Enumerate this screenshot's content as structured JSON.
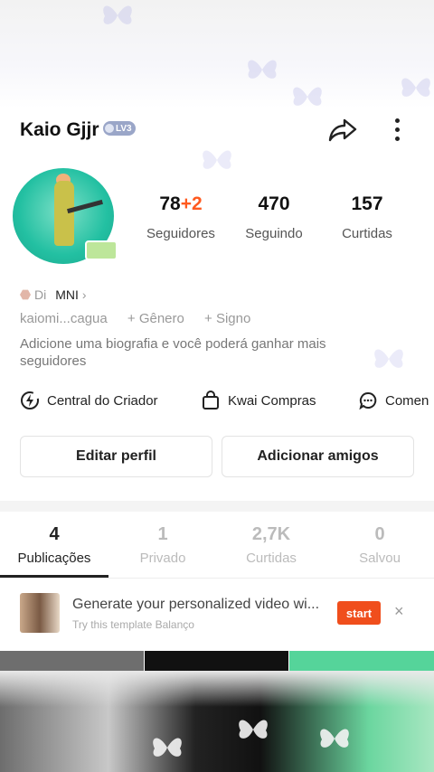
{
  "profile": {
    "username": "Kaio Gjjr",
    "level": "LV3",
    "stats": {
      "followers_num": "78",
      "followers_new": "+2",
      "followers_label": "Seguidores",
      "following_num": "470",
      "following_label": "Seguindo",
      "likes_num": "157",
      "likes_label": "Curtidas"
    },
    "tag_text": "Di",
    "tag_mn": "MNI",
    "tag_arrow": "›",
    "info": {
      "handle": "kaiomi...cagua",
      "gender": "+ Gênero",
      "sign": "+ Signo"
    },
    "bio": "Adicione uma biografia e você poderá ganhar mais seguidores"
  },
  "shortcuts": {
    "creator": "Central do Criador",
    "shop": "Kwai Compras",
    "comments": "Comen"
  },
  "buttons": {
    "edit": "Editar perfil",
    "add_friends": "Adicionar amigos"
  },
  "tabs": [
    {
      "num": "4",
      "label": "Publicações"
    },
    {
      "num": "1",
      "label": "Privado"
    },
    {
      "num": "2,7K",
      "label": "Curtidas"
    },
    {
      "num": "0",
      "label": "Salvou"
    }
  ],
  "banner": {
    "title": "Generate your personalized video wi...",
    "subtitle": "Try this template Balanço",
    "start": "start",
    "close": "×"
  },
  "colors": {
    "accent": "#f04e1c",
    "plus": "#ff5a1f"
  }
}
